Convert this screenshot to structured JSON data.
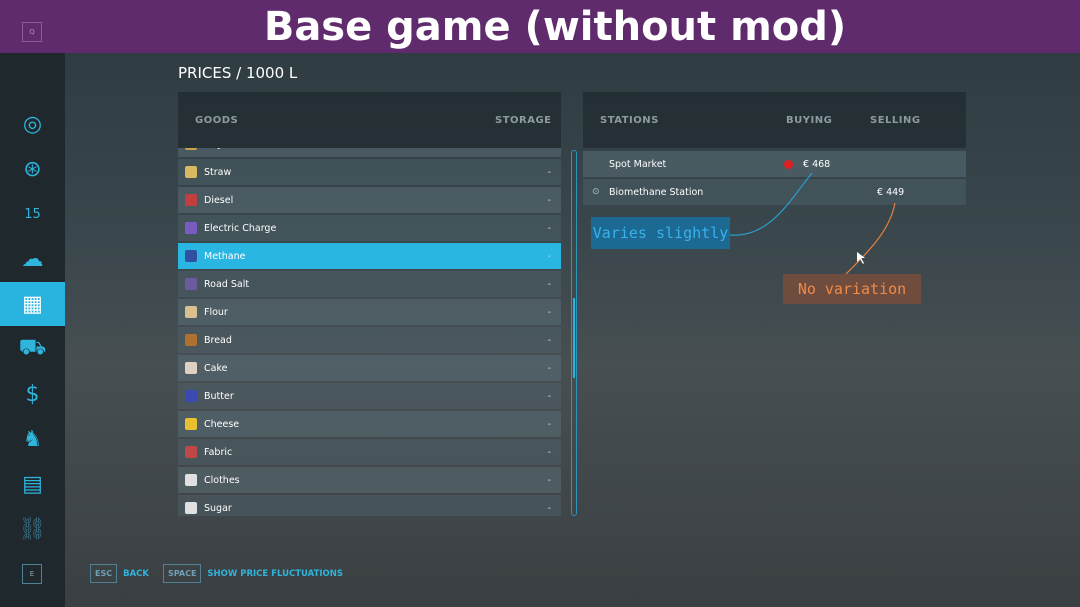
{
  "banner": {
    "title": "Base game (without mod)"
  },
  "keys": {
    "q": "Q",
    "e": "E"
  },
  "sidebar": {
    "items": [
      {
        "icon": "globe-icon",
        "glyph": "◎"
      },
      {
        "icon": "steering-wheel-icon",
        "glyph": "⊛"
      },
      {
        "icon": "calendar-icon",
        "glyph": "15"
      },
      {
        "icon": "weather-icon",
        "glyph": "☁"
      },
      {
        "icon": "prices-chart-icon",
        "glyph": "▦",
        "selected": true
      },
      {
        "icon": "tractor-icon",
        "glyph": "⛟"
      },
      {
        "icon": "finance-icon",
        "glyph": "$"
      },
      {
        "icon": "animals-icon",
        "glyph": "♞"
      },
      {
        "icon": "contracts-icon",
        "glyph": "▤"
      },
      {
        "icon": "production-icon",
        "glyph": "⛓"
      }
    ]
  },
  "page": {
    "title": "PRICES / 1000 L"
  },
  "goods": {
    "header": {
      "goods": "GOODS",
      "storage": "STORAGE"
    },
    "items": [
      {
        "name": "Hay",
        "storage": "-",
        "color": "#c9a34a"
      },
      {
        "name": "Straw",
        "storage": "-",
        "color": "#d8b860"
      },
      {
        "name": "Diesel",
        "storage": "-",
        "color": "#c04040"
      },
      {
        "name": "Electric Charge",
        "storage": "-",
        "color": "#7a5cc0"
      },
      {
        "name": "Methane",
        "storage": "-",
        "color": "#3050a0",
        "selected": true
      },
      {
        "name": "Road Salt",
        "storage": "-",
        "color": "#6a5aa0"
      },
      {
        "name": "Flour",
        "storage": "-",
        "color": "#d8c090"
      },
      {
        "name": "Bread",
        "storage": "-",
        "color": "#b07030"
      },
      {
        "name": "Cake",
        "storage": "-",
        "color": "#e0d0c0"
      },
      {
        "name": "Butter",
        "storage": "-",
        "color": "#3a4ab0"
      },
      {
        "name": "Cheese",
        "storage": "-",
        "color": "#e8c030"
      },
      {
        "name": "Fabric",
        "storage": "-",
        "color": "#c04848"
      },
      {
        "name": "Clothes",
        "storage": "-",
        "color": "#e0e0e0"
      },
      {
        "name": "Sugar",
        "storage": "-",
        "color": "#e0e0e0"
      }
    ]
  },
  "stations": {
    "header": {
      "stations": "STATIONS",
      "buying": "BUYING",
      "selling": "SELLING"
    },
    "rows": [
      {
        "name": "Spot Market",
        "buying": "€ 468",
        "selling": "",
        "indicator": "#e02020"
      },
      {
        "name": "Biomethane Station",
        "buying": "",
        "selling": "€ 449"
      }
    ]
  },
  "annotations": {
    "varies": "Varies slightly",
    "no_variation": "No variation",
    "varies_color": "#2a8fc0",
    "no_variation_color": "#e08040"
  },
  "footer": {
    "esc_key": "ESC",
    "esc_label": "BACK",
    "space_key": "SPACE",
    "space_label": "SHOW PRICE FLUCTUATIONS"
  }
}
